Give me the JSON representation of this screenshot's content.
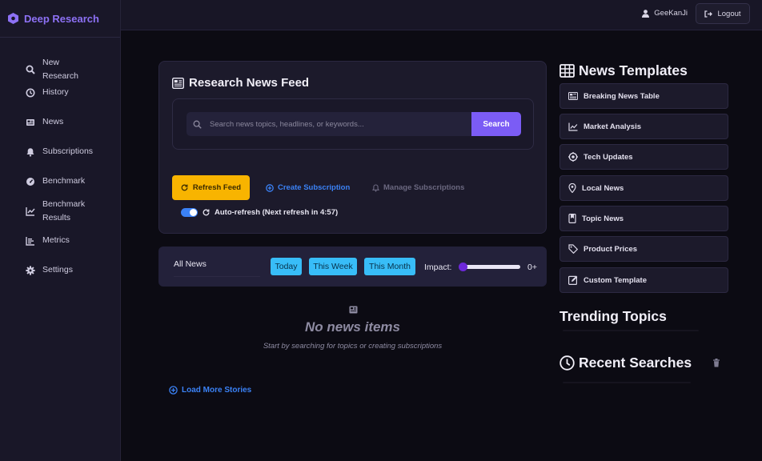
{
  "brand": {
    "name": "Deep Research",
    "icon": "hexagon-gear-icon",
    "color": "#8d71f5"
  },
  "sidebar": {
    "items": [
      {
        "label": "New Research",
        "icon": "search-icon"
      },
      {
        "label": "History",
        "icon": "history-icon"
      },
      {
        "label": "News",
        "icon": "newspaper-icon"
      },
      {
        "label": "Subscriptions",
        "icon": "bell-icon"
      },
      {
        "label": "Benchmark",
        "icon": "gauge-icon"
      },
      {
        "label": "Benchmark Results",
        "icon": "chart-line-icon"
      },
      {
        "label": "Metrics",
        "icon": "bar-chart-icon"
      },
      {
        "label": "Settings",
        "icon": "gear-icon"
      }
    ]
  },
  "header": {
    "username": "GeeKanJi",
    "logout_label": "Logout"
  },
  "feed": {
    "title": "Research News Feed",
    "search_placeholder": "Search news topics, headlines, or keywords...",
    "search_label": "Search",
    "refresh_label": "Refresh Feed",
    "create_subscription_label": "Create Subscription",
    "manage_subscriptions_label": "Manage Subscriptions",
    "auto_refresh_label": "Auto-refresh (Next refresh in 4:57)",
    "auto_refresh_enabled": true
  },
  "filters": {
    "category": "All News",
    "time_options": [
      "Today",
      "This Week",
      "This Month"
    ],
    "impact_label": "Impact:",
    "impact_value": "0+",
    "impact_level": 0
  },
  "empty_state": {
    "title": "No news items",
    "subtitle": "Start by searching for topics or creating subscriptions"
  },
  "load_more_label": "Load More Stories",
  "templates": {
    "heading": "News Templates",
    "items": [
      {
        "label": "Breaking News Table",
        "icon": "table-icon"
      },
      {
        "label": "Market Analysis",
        "icon": "chart-line-icon"
      },
      {
        "label": "Tech Updates",
        "icon": "microchip-icon"
      },
      {
        "label": "Local News",
        "icon": "map-pin-icon"
      },
      {
        "label": "Topic News",
        "icon": "bookmark-icon"
      },
      {
        "label": "Product Prices",
        "icon": "tag-icon"
      },
      {
        "label": "Custom Template",
        "icon": "edit-icon"
      }
    ]
  },
  "trending": {
    "heading": "Trending Topics"
  },
  "recent": {
    "heading": "Recent Searches"
  },
  "colors": {
    "accent": "#7b5cf5",
    "refresh": "#f8b400",
    "link": "#3b82f6",
    "chip": "#38bdf8"
  }
}
